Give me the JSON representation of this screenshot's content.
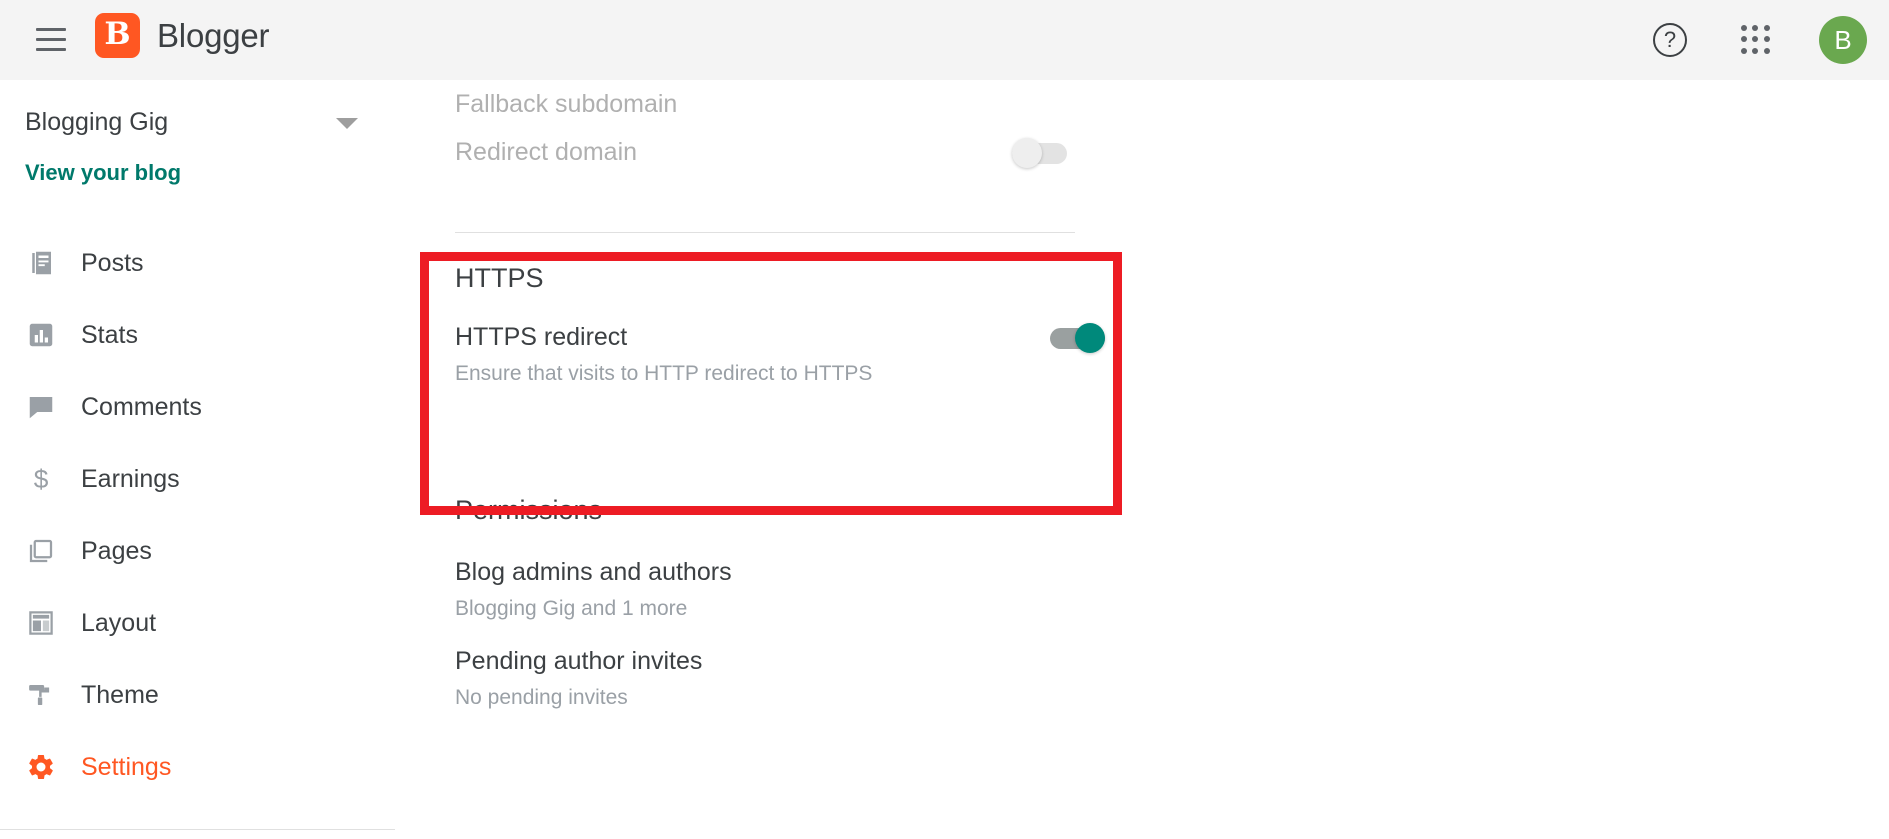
{
  "header": {
    "menu_icon": "hamburger-icon",
    "brand_initial": "B",
    "brand_name": "Blogger",
    "help_glyph": "?",
    "apps_icon": "apps-grid-icon",
    "avatar_initial": "B"
  },
  "sidebar": {
    "blog_name": "Blogging Gig",
    "view_blog_label": "View your blog",
    "items": [
      {
        "label": "Posts",
        "icon": "posts-icon",
        "active": false
      },
      {
        "label": "Stats",
        "icon": "stats-icon",
        "active": false
      },
      {
        "label": "Comments",
        "icon": "comments-icon",
        "active": false
      },
      {
        "label": "Earnings",
        "icon": "earnings-icon",
        "active": false
      },
      {
        "label": "Pages",
        "icon": "pages-icon",
        "active": false
      },
      {
        "label": "Layout",
        "icon": "layout-icon",
        "active": false
      },
      {
        "label": "Theme",
        "icon": "theme-icon",
        "active": false
      },
      {
        "label": "Settings",
        "icon": "settings-icon",
        "active": true
      }
    ]
  },
  "main": {
    "fallback_subdomain": {
      "label": "Fallback subdomain",
      "state": "disabled"
    },
    "redirect_domain": {
      "label": "Redirect domain",
      "state": "disabled",
      "toggle": "off"
    },
    "https": {
      "heading": "HTTPS",
      "redirect_label": "HTTPS redirect",
      "redirect_description": "Ensure that visits to HTTP redirect to HTTPS",
      "toggle": "on"
    },
    "permissions": {
      "heading": "Permissions",
      "rows": [
        {
          "label": "Blog admins and authors",
          "value": "Blogging Gig and 1 more"
        },
        {
          "label": "Pending author invites",
          "value": "No pending invites"
        }
      ]
    }
  },
  "colors": {
    "brand_orange": "#ff5722",
    "accent_teal": "#00796b",
    "toggle_on": "#00897b",
    "highlight_red": "#ed1c24",
    "avatar_green": "#6aa84f",
    "header_bg": "#f4f4f4"
  }
}
